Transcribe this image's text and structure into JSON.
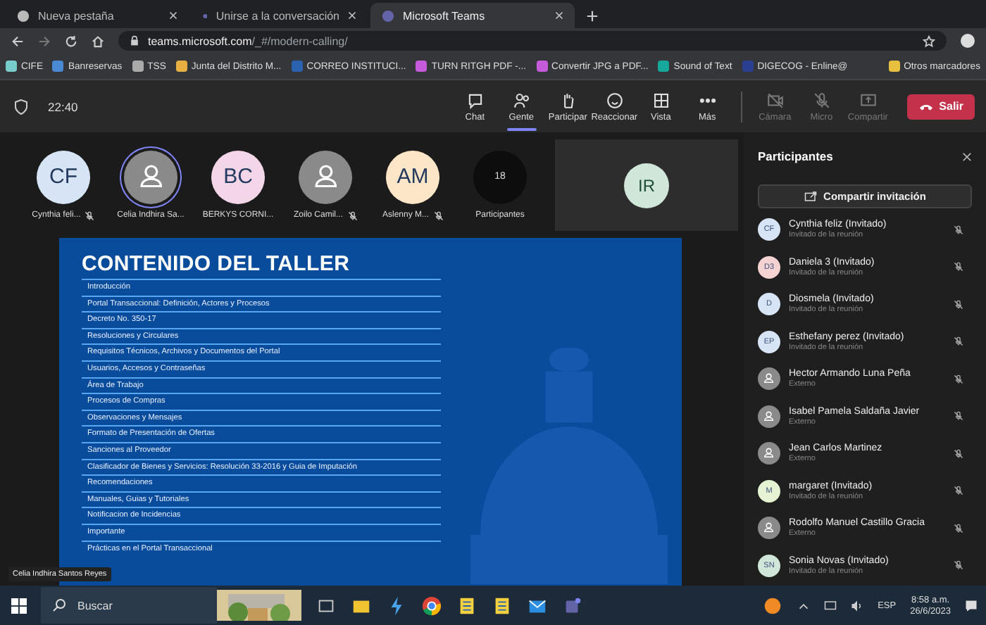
{
  "browser": {
    "tabs": [
      {
        "title": "Nueva pestaña",
        "selected": false
      },
      {
        "title": "Unirse a la conversación",
        "selected": false
      },
      {
        "title": "Microsoft Teams",
        "selected": true
      }
    ],
    "url": {
      "host": "teams.microsoft.com",
      "path": "/_#/modern-calling/"
    },
    "bookmarks": [
      "CIFE",
      "Banreservas",
      "TSS",
      "Junta del Distrito M...",
      "CORREO INSTITUCI...",
      "TURN RITGH PDF -...",
      "Convertir JPG a PDF...",
      "Sound of Text",
      "DIGECOG - Enline@",
      "Otros marcadores"
    ]
  },
  "meeting_bar": {
    "time": "22:40",
    "buttons": [
      {
        "label": "Chat",
        "selected": false,
        "disabled": false
      },
      {
        "label": "Gente",
        "selected": true,
        "disabled": false
      },
      {
        "label": "Participar",
        "selected": false,
        "disabled": false
      },
      {
        "label": "Reaccionar",
        "selected": false,
        "disabled": false
      },
      {
        "label": "Vista",
        "selected": false,
        "disabled": false
      },
      {
        "label": "Más",
        "selected": false,
        "disabled": false
      },
      {
        "label": "Cámara",
        "selected": false,
        "disabled": true
      },
      {
        "label": "Micro",
        "selected": false,
        "disabled": true
      },
      {
        "label": "Compartir",
        "selected": false,
        "disabled": true
      }
    ],
    "leave": "Salir"
  },
  "gallery": [
    {
      "kind": "initials",
      "initials": "CF",
      "color": "#d6e4f5",
      "name": "Cynthia feli...",
      "muted": true,
      "speaking": false
    },
    {
      "kind": "person",
      "name": "Celia Indhira Sa...",
      "muted": false,
      "speaking": true
    },
    {
      "kind": "initials",
      "initials": "BC",
      "color": "#f3d6e8",
      "name": "BERKYS CORNI...",
      "muted": false,
      "speaking": false
    },
    {
      "kind": "person",
      "name": "Zoilo Camil...",
      "muted": true,
      "speaking": false
    },
    {
      "kind": "initials",
      "initials": "AM",
      "color": "#fde6c8",
      "name": "Aslenny M...",
      "muted": true,
      "speaking": false
    },
    {
      "kind": "count",
      "initials": "18",
      "name": "Participantes",
      "muted": false,
      "speaking": false
    }
  ],
  "video_tile": {
    "initials": "IR",
    "color": "#cfe6d8"
  },
  "slide": {
    "title": "CONTENIDO DEL TALLER",
    "items": [
      "Introducción",
      "Portal Transaccional: Definición, Actores y Procesos",
      "Decreto No. 350-17",
      "Resoluciones y Circulares",
      "Requisitos Técnicos, Archivos y Documentos del Portal",
      "Usuarios, Accesos y Contraseñas",
      "Área de Trabajo",
      "Procesos de Compras",
      "Observaciones y Mensajes",
      "Formato de Presentación de Ofertas",
      "Sanciones al Proveedor",
      "Clasificador de Bienes y Servicios: Resolución 33-2016 y Guia de Imputación",
      "Recomendaciones",
      "Manuales, Guias y Tutoriales",
      "Notificacion de Incidencias",
      "Importante",
      "Prácticas en el Portal Transaccional"
    ]
  },
  "speaker_caption": "Celia Indhira Santos Reyes",
  "panel": {
    "title": "Participantes",
    "share_button": "Compartir invitación",
    "participants": [
      {
        "kind": "initials",
        "initials": "CF",
        "color": "#d6e4f5",
        "name": "Cynthia feliz (Invitado)",
        "role": "Invitado de la reunión",
        "muted": true
      },
      {
        "kind": "initials",
        "initials": "D3",
        "color": "#f6d3d3",
        "name": "Daniela 3 (Invitado)",
        "role": "Invitado de la reunión",
        "muted": true
      },
      {
        "kind": "initials",
        "initials": "D",
        "color": "#d6e4f5",
        "name": "Diosmela (Invitado)",
        "role": "Invitado de la reunión",
        "muted": true
      },
      {
        "kind": "initials",
        "initials": "EP",
        "color": "#d6e4f5",
        "name": "Esthefany perez (Invitado)",
        "role": "Invitado de la reunión",
        "muted": true
      },
      {
        "kind": "person",
        "name": "Hector Armando Luna Peña",
        "role": "Externo",
        "muted": true
      },
      {
        "kind": "person",
        "name": "Isabel Pamela Saldaña Javier",
        "role": "Externo",
        "muted": true
      },
      {
        "kind": "person",
        "name": "Jean Carlos Martinez",
        "role": "Externo",
        "muted": true
      },
      {
        "kind": "initials",
        "initials": "M",
        "color": "#e6f3d3",
        "name": "margaret (Invitado)",
        "role": "Invitado de la reunión",
        "muted": true
      },
      {
        "kind": "person",
        "name": "Rodolfo Manuel Castillo Gracia",
        "role": "Externo",
        "muted": true
      },
      {
        "kind": "initials",
        "initials": "SN",
        "color": "#cfe6d8",
        "name": "Sonia Novas (Invitado)",
        "role": "Invitado de la reunión",
        "muted": true
      }
    ]
  },
  "taskbar": {
    "search_placeholder": "Buscar",
    "language": "ESP",
    "time": "8:58 a.m.",
    "date": "26/6/2023"
  }
}
